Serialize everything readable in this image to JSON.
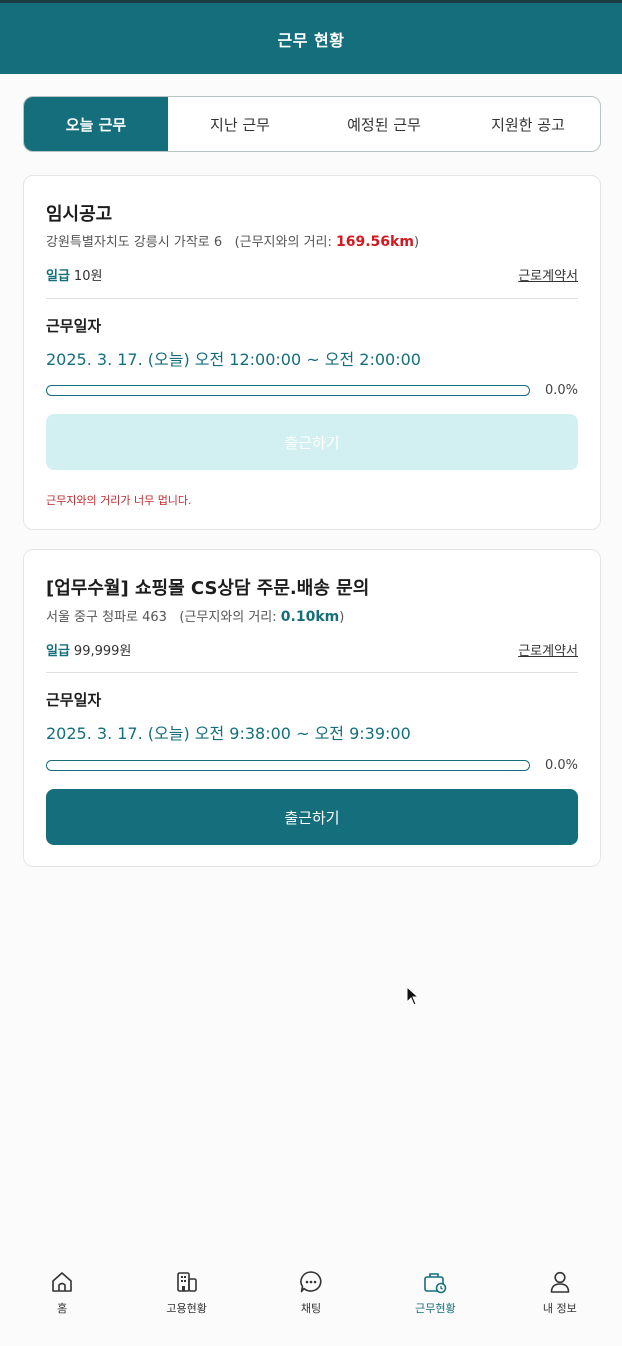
{
  "header": {
    "title": "근무 현황"
  },
  "tabs": [
    {
      "label": "오늘 근무",
      "active": true
    },
    {
      "label": "지난 근무",
      "active": false
    },
    {
      "label": "예정된 근무",
      "active": false
    },
    {
      "label": "지원한 공고",
      "active": false
    }
  ],
  "jobs": [
    {
      "title": "임시공고",
      "address": "강원특별자치도 강릉시 가작로 6",
      "distance_prefix": "(근무지와의 거리: ",
      "distance_value": "169.56km",
      "distance_suffix": ")",
      "pay_label": "일급",
      "pay_amount": "10원",
      "contract_label": "근로계약서",
      "date_label": "근무일자",
      "date_range": "2025. 3. 17. (오늘) 오전 12:00:00 ~ 오전 2:00:00",
      "progress_pct": "0.0%",
      "progress_fraction": 0,
      "button_label": "출근하기",
      "button_enabled": false,
      "warning": "근무지와의 거리가 너무 멉니다."
    },
    {
      "title": "[업무수월] 쇼핑몰 CS상담 주문.배송 문의",
      "address": "서울 중구 청파로 463",
      "distance_prefix": "(근무지와의 거리: ",
      "distance_value": "0.10km",
      "distance_suffix": ")",
      "pay_label": "일급",
      "pay_amount": "99,999원",
      "contract_label": "근로계약서",
      "date_label": "근무일자",
      "date_range": "2025. 3. 17. (오늘) 오전 9:38:00 ~ 오전 9:39:00",
      "progress_pct": "0.0%",
      "progress_fraction": 0,
      "button_label": "출근하기",
      "button_enabled": true
    }
  ],
  "bottom_nav": [
    {
      "label": "홈",
      "icon": "home-icon",
      "active": false
    },
    {
      "label": "고용현황",
      "icon": "building-icon",
      "active": false
    },
    {
      "label": "채팅",
      "icon": "chat-icon",
      "active": false
    },
    {
      "label": "근무현황",
      "icon": "work-status-icon",
      "active": true
    },
    {
      "label": "내 정보",
      "icon": "user-icon",
      "active": false
    }
  ],
  "colors": {
    "primary": "#156e7c",
    "distance_far": "#d3191f",
    "button_disabled": "#d2f0f2",
    "warning": "#c0282d"
  }
}
